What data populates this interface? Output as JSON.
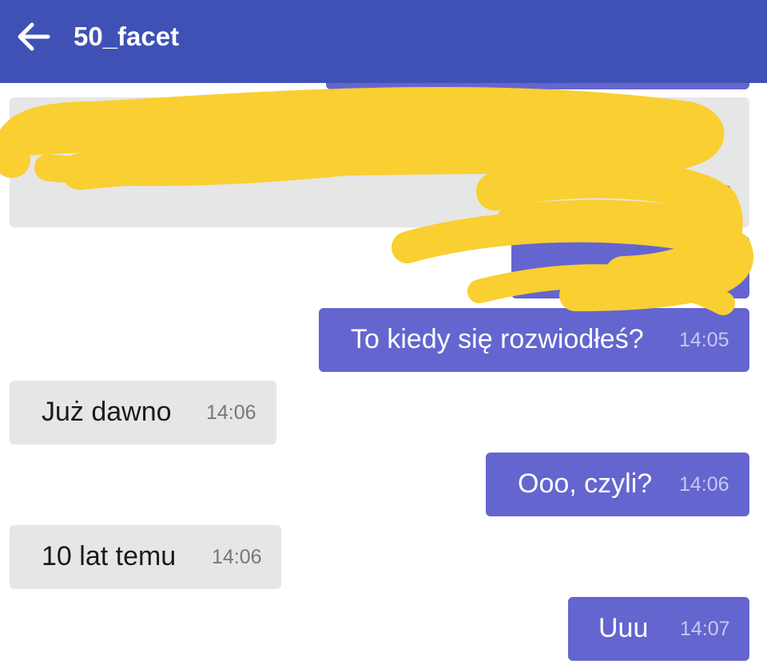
{
  "header": {
    "back_icon": "arrow-left-icon",
    "title": "50_facet",
    "background": "#3f51b5"
  },
  "colors": {
    "outgoing_bubble": "#6565cf",
    "incoming_bubble": "#e6e6e6",
    "redaction": "#f9cf32"
  },
  "redacted": {
    "partial_time": "3"
  },
  "messages": [
    {
      "direction": "outgoing",
      "text": "To kiedy się rozwiodłeś?",
      "time": "14:05"
    },
    {
      "direction": "incoming",
      "text": "Już dawno",
      "time": "14:06"
    },
    {
      "direction": "outgoing",
      "text": "Ooo, czyli?",
      "time": "14:06"
    },
    {
      "direction": "incoming",
      "text": "10 lat temu",
      "time": "14:06"
    },
    {
      "direction": "outgoing",
      "text": "Uuu",
      "time": "14:07"
    }
  ]
}
